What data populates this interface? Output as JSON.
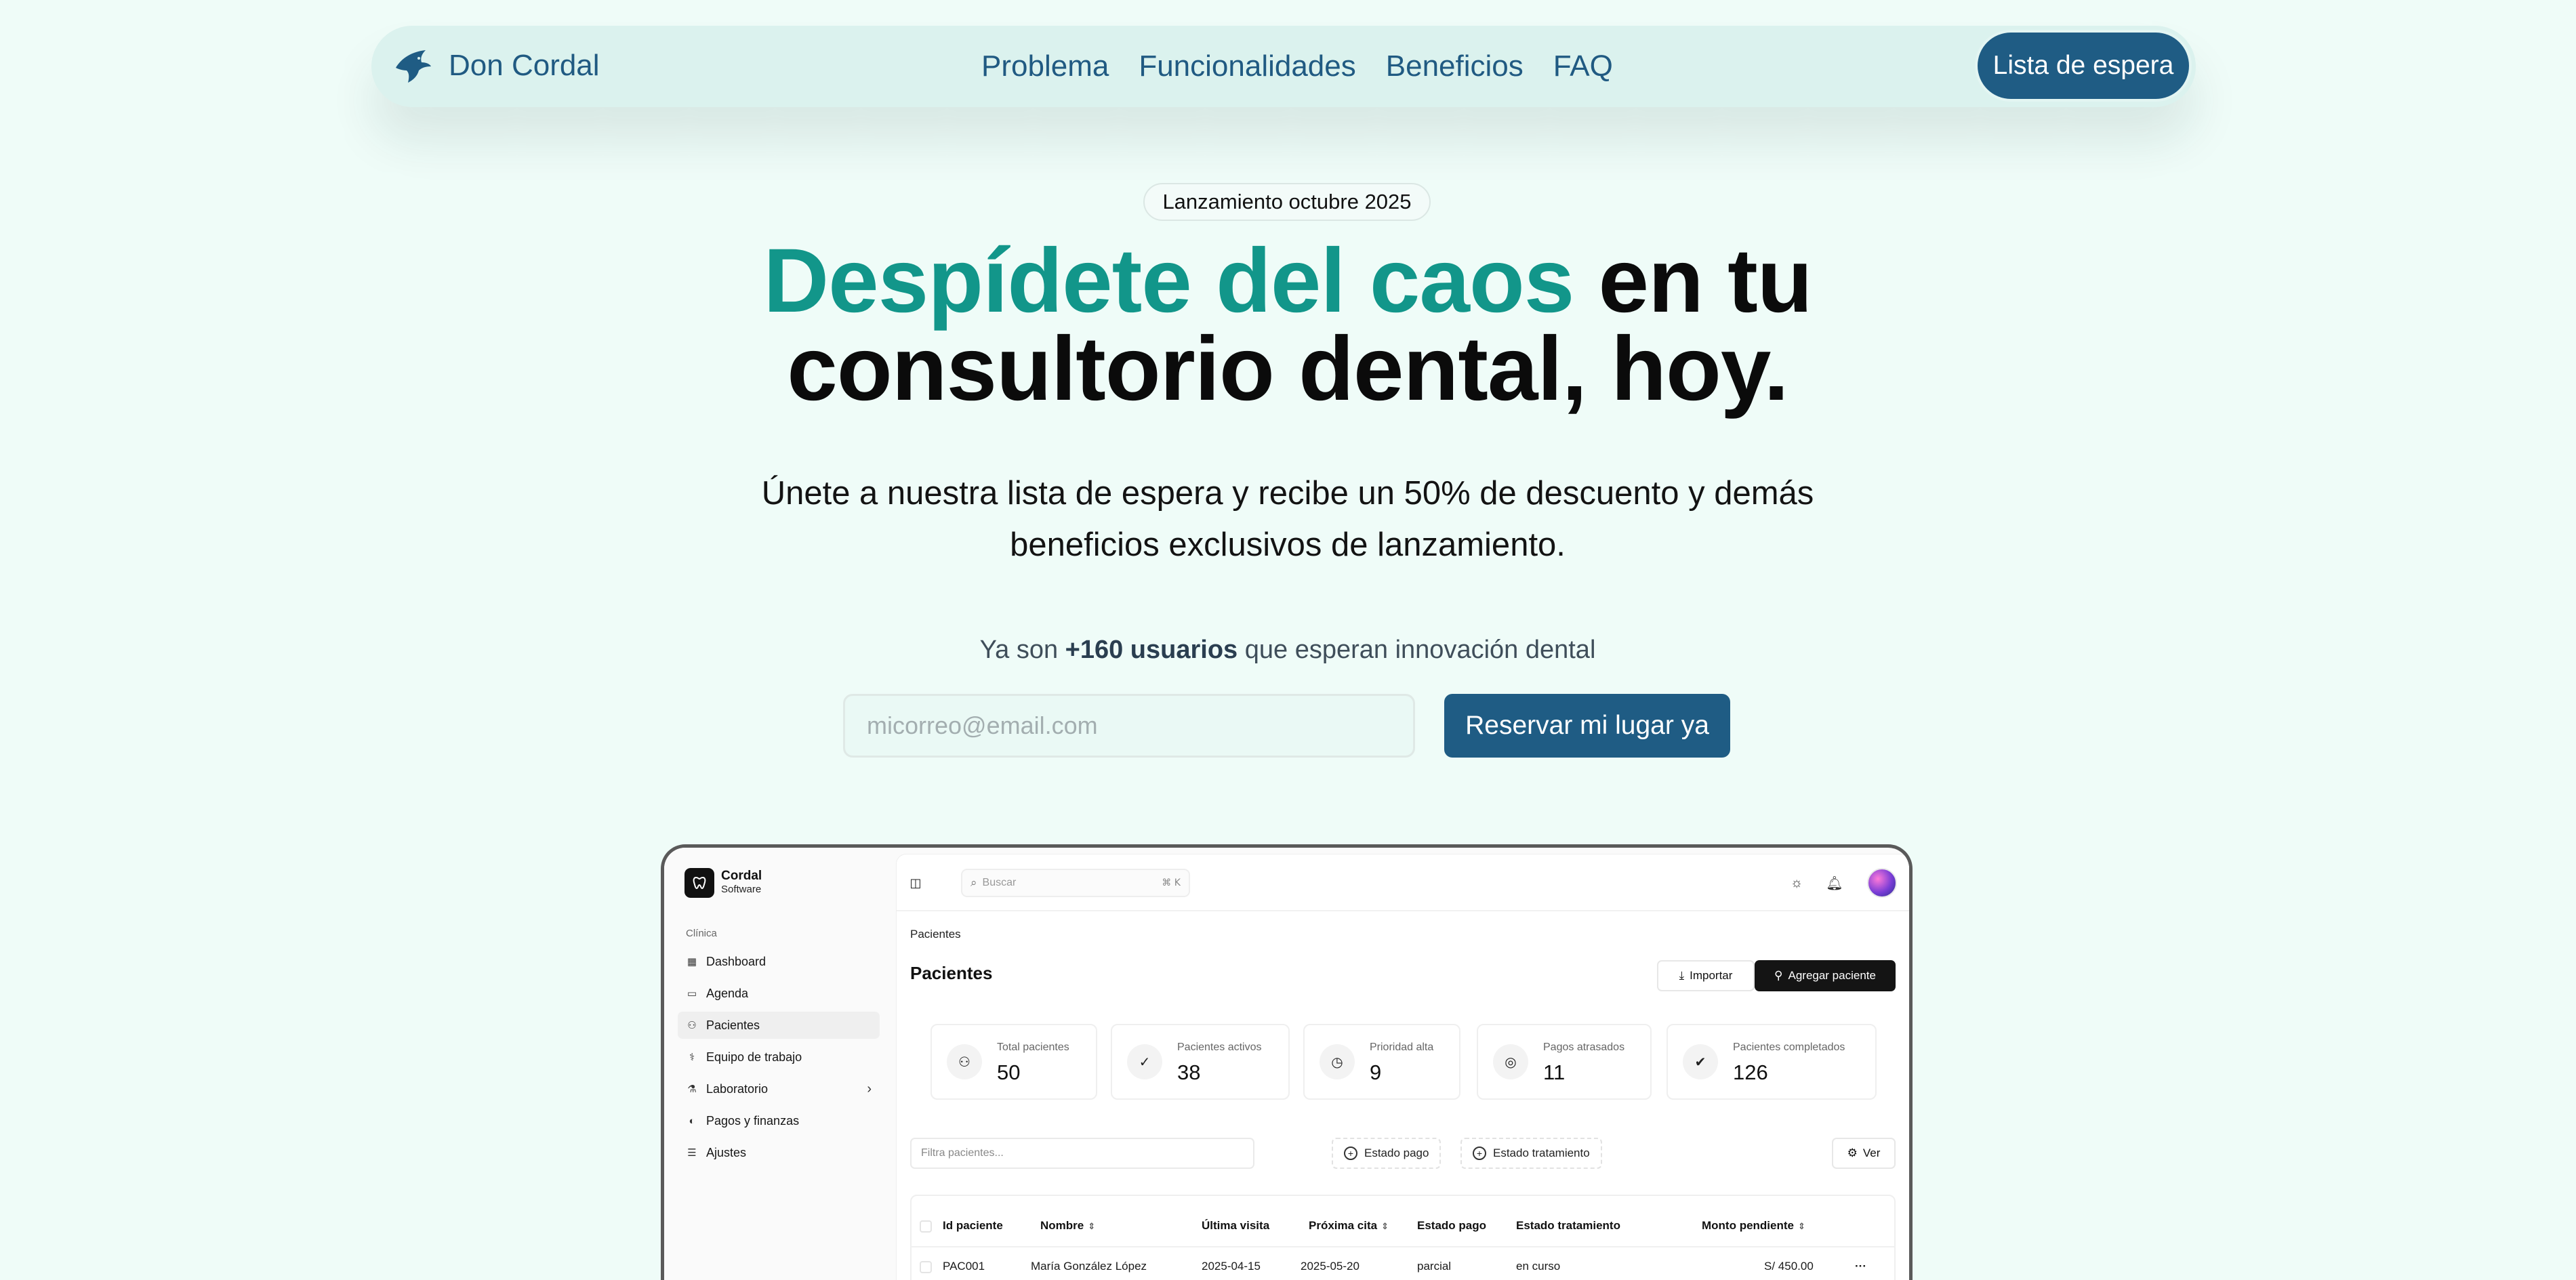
{
  "nav": {
    "brand": "Don Cordal",
    "links": [
      "Problema",
      "Funcionalidades",
      "Beneficios",
      "FAQ"
    ],
    "cta": "Lista de espera"
  },
  "hero": {
    "badge": "Lanzamiento octubre 2025",
    "headline_accent": "Despídete del caos",
    "headline_rest_1": " en tu",
    "headline_rest_2": "consultorio dental, hoy.",
    "subtitle_1": "Únete a nuestra lista de espera y recibe un 50% de descuento y demás",
    "subtitle_2": "beneficios exclusivos de lanzamiento.",
    "social_prefix": "Ya son ",
    "social_bold": "+160 usuarios",
    "social_suffix": " que esperan innovación dental",
    "email_placeholder": "micorreo@email.com",
    "submit": "Reservar mi lugar ya"
  },
  "app": {
    "brand_name": "Cordal",
    "brand_sub": "Software",
    "section": "Clínica",
    "sidebar": [
      {
        "label": "Dashboard",
        "icon": "dashboard-icon"
      },
      {
        "label": "Agenda",
        "icon": "calendar-icon"
      },
      {
        "label": "Pacientes",
        "icon": "users-icon"
      },
      {
        "label": "Equipo de trabajo",
        "icon": "stethoscope-icon"
      },
      {
        "label": "Laboratorio",
        "icon": "flask-icon"
      },
      {
        "label": "Pagos y finanzas",
        "icon": "money-icon"
      },
      {
        "label": "Ajustes",
        "icon": "settings-icon"
      }
    ],
    "search_placeholder": "Buscar",
    "search_shortcut": "⌘ K",
    "breadcrumb": "Pacientes",
    "title": "Pacientes",
    "import_label": "Importar",
    "add_label": "Agregar paciente",
    "stats": [
      {
        "label": "Total pacientes",
        "value": "50"
      },
      {
        "label": "Pacientes activos",
        "value": "38"
      },
      {
        "label": "Prioridad alta",
        "value": "9"
      },
      {
        "label": "Pagos atrasados",
        "value": "11"
      },
      {
        "label": "Pacientes completados",
        "value": "126"
      }
    ],
    "filter_placeholder": "Filtra pacientes...",
    "chip_payment": "Estado pago",
    "chip_treatment": "Estado tratamiento",
    "view_label": "Ver",
    "columns": [
      "Id paciente",
      "Nombre",
      "Última visita",
      "Próxima cita",
      "Estado pago",
      "Estado tratamiento",
      "Monto pendiente"
    ],
    "rows": [
      {
        "id": "PAC001",
        "name": "María González López",
        "last": "2025-04-15",
        "next": "2025-05-20",
        "pay": "parcial",
        "treat": "en curso",
        "amount": "S/ 450.00"
      }
    ],
    "more": "···"
  }
}
